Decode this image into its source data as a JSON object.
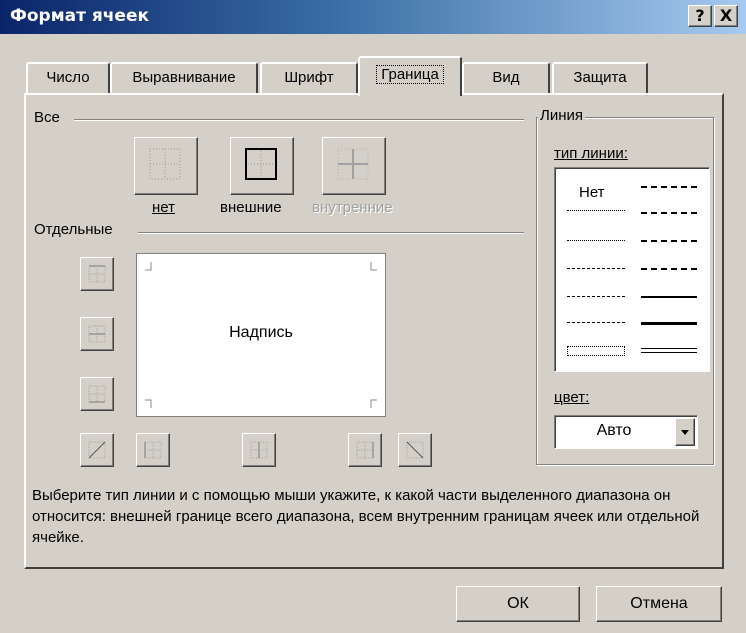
{
  "window": {
    "title": "Формат ячеек",
    "help_button": "?",
    "close_button": "X"
  },
  "tabs": [
    {
      "label": "Число",
      "active": false
    },
    {
      "label": "Выравнивание",
      "active": false
    },
    {
      "label": "Шрифт",
      "active": false
    },
    {
      "label": "Граница",
      "active": true
    },
    {
      "label": "Вид",
      "active": false
    },
    {
      "label": "Защита",
      "active": false
    }
  ],
  "presets": {
    "group_label": "Все",
    "none_label": "нет",
    "outline_label": "внешние",
    "inside_label": "внутренние"
  },
  "border": {
    "group_label": "Отдельные",
    "preview_text": "Надпись"
  },
  "line": {
    "group_label": "Линия",
    "style_label": "тип линии:",
    "none_option": "Нет",
    "color_label": "цвет:",
    "color_value": "Авто"
  },
  "hint": "Выберите тип линии и с помощью мыши укажите, к какой части выделенного диапазона он относится: внешней границе всего диапазона, всем внутренним границам ячеек или отдельной ячейке.",
  "buttons": {
    "ok": "ОК",
    "cancel": "Отмена"
  },
  "colors": {
    "titlebar_start": "#0a246a",
    "titlebar_end": "#a6caf0",
    "face": "#d4d0c8"
  }
}
